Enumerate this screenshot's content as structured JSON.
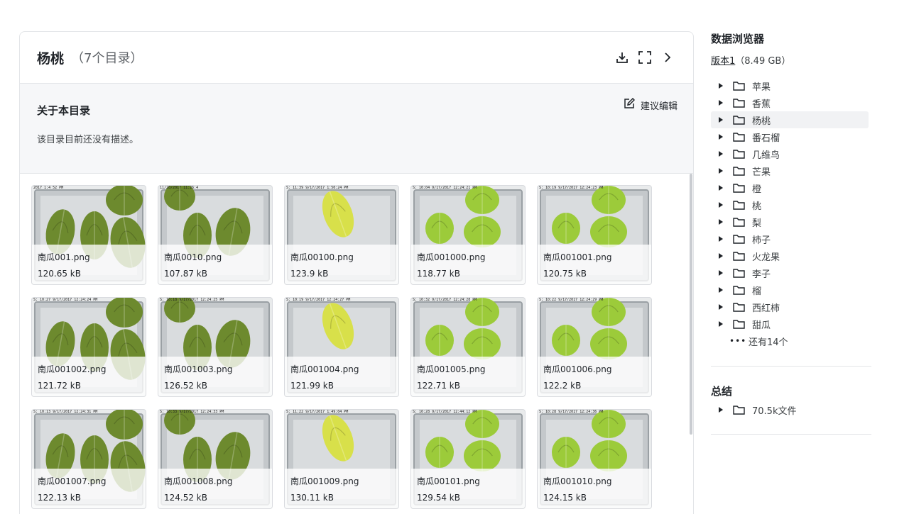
{
  "header": {
    "title": "杨桃",
    "count": "（7个目录）"
  },
  "about": {
    "title": "关于本目录",
    "description": "该目录目前还没有描述。",
    "suggest_label": "建议编辑"
  },
  "files": [
    {
      "name": "南瓜001.png",
      "size": "120.65 kB",
      "stamp": "2017 1:4 52 PM"
    },
    {
      "name": "南瓜0010.png",
      "size": "107.87 kB",
      "stamp": "11/20/2017 11:26:4"
    },
    {
      "name": "南瓜00100.png",
      "size": "123.9 kB",
      "stamp": "S: 11:39 9/17/2017 1:50:24 PM"
    },
    {
      "name": "南瓜001000.png",
      "size": "118.77 kB",
      "stamp": "S: 10:04 9/17/2017 12:24:21 PM"
    },
    {
      "name": "南瓜001001.png",
      "size": "120.75 kB",
      "stamp": "S: 10:19 9/17/2017 12:24:23 PM"
    },
    {
      "name": "南瓜001002.png",
      "size": "121.72 kB",
      "stamp": "S: 10:27 9/17/2017 12:24:24 PM"
    },
    {
      "name": "南瓜001003.png",
      "size": "126.52 kB",
      "stamp": "S: 10:18 9/17/2017 12:24:25 PM"
    },
    {
      "name": "南瓜001004.png",
      "size": "121.99 kB",
      "stamp": "S: 10:19 9/17/2017 12:24:27 PM"
    },
    {
      "name": "南瓜001005.png",
      "size": "122.71 kB",
      "stamp": "S: 10:32 9/17/2017 12:24:28 PM"
    },
    {
      "name": "南瓜001006.png",
      "size": "122.2 kB",
      "stamp": "S: 10:22 9/17/2017 12:24:29 PM"
    },
    {
      "name": "南瓜001007.png",
      "size": "122.13 kB",
      "stamp": "S: 10:13 9/17/2017 12:24:31 PM"
    },
    {
      "name": "南瓜001008.png",
      "size": "124.52 kB",
      "stamp": "S: 10:33 9/17/2017 12:24:33 PM"
    },
    {
      "name": "南瓜001009.png",
      "size": "130.11 kB",
      "stamp": "S: 11:22 9/17/2017 1:49:04 PM"
    },
    {
      "name": "南瓜00101.png",
      "size": "129.54 kB",
      "stamp": "S: 10:28 9/17/2017 12:44:12 PM"
    },
    {
      "name": "南瓜001010.png",
      "size": "124.15 kB",
      "stamp": "S: 10:28 9/17/2017 12:24:36 PM"
    }
  ],
  "sidebar": {
    "title": "数据浏览器",
    "version_label": "版本1",
    "version_size": "（8.49 GB）",
    "tree": [
      {
        "label": "苹果"
      },
      {
        "label": "香蕉"
      },
      {
        "label": "杨桃"
      },
      {
        "label": "番石榴"
      },
      {
        "label": "几维鸟"
      },
      {
        "label": "芒果"
      },
      {
        "label": "橙"
      },
      {
        "label": "桃"
      },
      {
        "label": "梨"
      },
      {
        "label": "柿子"
      },
      {
        "label": "火龙果"
      },
      {
        "label": "李子"
      },
      {
        "label": "榴"
      },
      {
        "label": "西红柿"
      },
      {
        "label": "甜瓜"
      }
    ],
    "more_label": "还有14个",
    "summary_title": "总结",
    "summary_item": "70.5k文件"
  },
  "colors": {
    "fruit_green": "#9ccb3a",
    "fruit_yellow": "#d8e04a",
    "fruit_dark": "#6d8a2e",
    "tray": "#c4c8cb",
    "selected_row": "#f1f2f4"
  },
  "icons": [
    "download-icon",
    "fullscreen-icon",
    "chevron-right-icon",
    "edit-icon",
    "caret-right-icon",
    "folder-icon",
    "more-icon"
  ]
}
